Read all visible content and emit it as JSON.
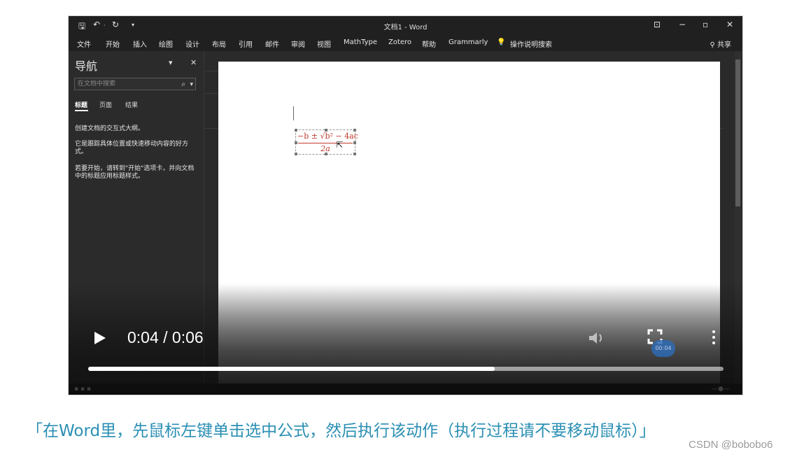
{
  "window": {
    "title": "文档1 - Word",
    "quick_access": [
      "save-icon",
      "undo-icon",
      "redo-icon",
      "customize-icon"
    ],
    "controls": [
      "ribbon-display-icon",
      "minimize-icon",
      "restore-icon",
      "close-icon"
    ]
  },
  "ribbon": {
    "tabs": [
      "文件",
      "开始",
      "插入",
      "绘图",
      "设计",
      "布局",
      "引用",
      "邮件",
      "审阅",
      "视图",
      "MathType",
      "Zotero",
      "帮助",
      "Grammarly"
    ],
    "tell_me": "操作说明搜索",
    "share": "共享"
  },
  "nav_pane": {
    "title": "导航",
    "search_placeholder": "在文档中搜索",
    "tabs": [
      "标题",
      "页面",
      "结果"
    ],
    "active_tab": "标题",
    "text1": "创建文档的交互式大纲。",
    "text2": "它是跟踪具体位置或快速移动内容的好方式。",
    "text3": "若要开始，请转到\"开始\"选项卡，并向文档中的标题应用标题样式。"
  },
  "document": {
    "equation_numerator": "−b ± √b² − 4ac",
    "equation_denominator": "2a",
    "equation_color": "#c0392b"
  },
  "player": {
    "time": "0:04 / 0:06",
    "progress": 0.64,
    "timestamp_badge": "00:04",
    "icons": [
      "play-icon",
      "volume-icon",
      "fullscreen-icon",
      "more-icon"
    ]
  },
  "caption": "「在Word里，先鼠标左键单击选中公式，然后执行该动作（执行过程请不要移动鼠标）」",
  "watermark": "CSDN @bobobo6",
  "colors": {
    "caption": "#2a8fb3",
    "accent_badge": "#2e6bb4"
  }
}
